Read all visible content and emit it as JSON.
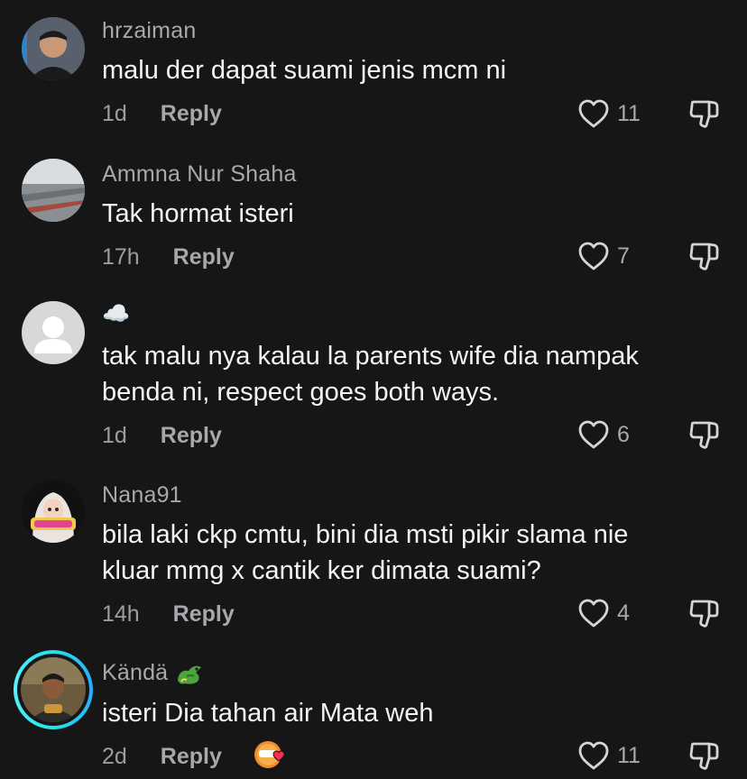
{
  "comments": [
    {
      "username": "hrzaiman",
      "text": "malu der dapat suami jenis mcm ni",
      "time": "1d",
      "reply_label": "Reply",
      "likes": "11"
    },
    {
      "username": "Ammna Nur Shaha",
      "text": "Tak hormat isteri",
      "time": "17h",
      "reply_label": "Reply",
      "likes": "7"
    },
    {
      "username": "☁️",
      "text_line1": "tak malu nya kalau la parents wife dia nampak",
      "text_line2": "benda ni, respect goes both ways.",
      "time": "1d",
      "reply_label": "Reply",
      "likes": "6"
    },
    {
      "username": "Nana91",
      "text_line1": "bila laki ckp cmtu, bini dia msti pikir slama nie",
      "text_line2": "kluar mmg x cantik ker dimata suami?",
      "time": "14h",
      "reply_label": "Reply",
      "likes": "4"
    },
    {
      "username": "Kändä",
      "username_emoji": "dragon-emoji",
      "text": "isteri Dia tahan air Mata weh",
      "time": "2d",
      "reply_label": "Reply",
      "likes": "11",
      "creator_liked_badge": "creator-liked-icon"
    }
  ],
  "colors": {
    "background": "#161616",
    "text_primary": "#f4f4f4",
    "text_secondary": "#a9a9ad",
    "story_ring": "#27e0e8"
  }
}
